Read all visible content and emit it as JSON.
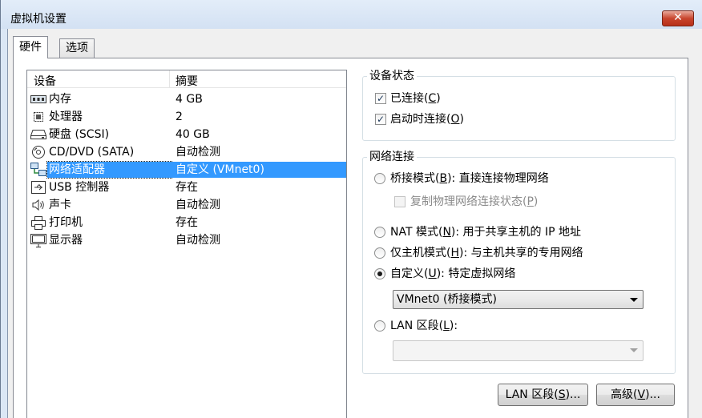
{
  "window": {
    "title": "虚拟机设置",
    "close_label": "✕"
  },
  "tabs": [
    {
      "label": "硬件",
      "active": true
    },
    {
      "label": "选项",
      "active": false
    }
  ],
  "device_list": {
    "columns": {
      "device": "设备",
      "summary": "摘要"
    },
    "rows": [
      {
        "icon": "memory-icon",
        "name": "内存",
        "summary": "4 GB",
        "selected": false
      },
      {
        "icon": "processor-icon",
        "name": "处理器",
        "summary": "2",
        "selected": false
      },
      {
        "icon": "hard-disk-icon",
        "name": "硬盘 (SCSI)",
        "summary": "40 GB",
        "selected": false
      },
      {
        "icon": "cd-dvd-icon",
        "name": "CD/DVD (SATA)",
        "summary": "自动检测",
        "selected": false
      },
      {
        "icon": "network-adapter-icon",
        "name": "网络适配器",
        "summary": "自定义 (VMnet0)",
        "selected": true
      },
      {
        "icon": "usb-icon",
        "name": "USB 控制器",
        "summary": "存在",
        "selected": false
      },
      {
        "icon": "sound-icon",
        "name": "声卡",
        "summary": "自动检测",
        "selected": false
      },
      {
        "icon": "printer-icon",
        "name": "打印机",
        "summary": "存在",
        "selected": false
      },
      {
        "icon": "display-icon",
        "name": "显示器",
        "summary": "自动检测",
        "selected": false
      }
    ]
  },
  "device_status": {
    "title": "设备状态",
    "connected": {
      "text": "已连接(",
      "key": "C",
      "end": ")",
      "checked": true
    },
    "connect_at_power_on": {
      "text": "启动时连接(",
      "key": "O",
      "end": ")",
      "checked": true
    }
  },
  "network_connection": {
    "title": "网络连接",
    "bridged": {
      "text": "桥接模式(",
      "key": "B",
      "end": "): 直接连接物理网络",
      "selected": false
    },
    "replicate": {
      "text": "复制物理网络连接状态(",
      "key": "P",
      "end": ")",
      "checked": false,
      "disabled": true
    },
    "nat": {
      "text": "NAT 模式(",
      "key": "N",
      "end": "): 用于共享主机的 IP 地址",
      "selected": false
    },
    "host_only": {
      "text": "仅主机模式(",
      "key": "H",
      "end": "): 与主机共享的专用网络",
      "selected": false
    },
    "custom": {
      "text": "自定义(",
      "key": "U",
      "end": "): 特定虚拟网络",
      "selected": true
    },
    "custom_select_value": "VMnet0 (桥接模式)",
    "lan": {
      "text": "LAN 区段(",
      "key": "L",
      "end": "):",
      "selected": false
    },
    "lan_select_value": ""
  },
  "buttons": {
    "lan_segments": {
      "text": "LAN 区段(",
      "key": "S",
      "end": ")..."
    },
    "advanced": {
      "text": "高级(",
      "key": "V",
      "end": ")..."
    }
  },
  "colors": {
    "selection": "#3399ff",
    "title_bar": "#dbe7f5",
    "close_button": "#c8452e"
  }
}
